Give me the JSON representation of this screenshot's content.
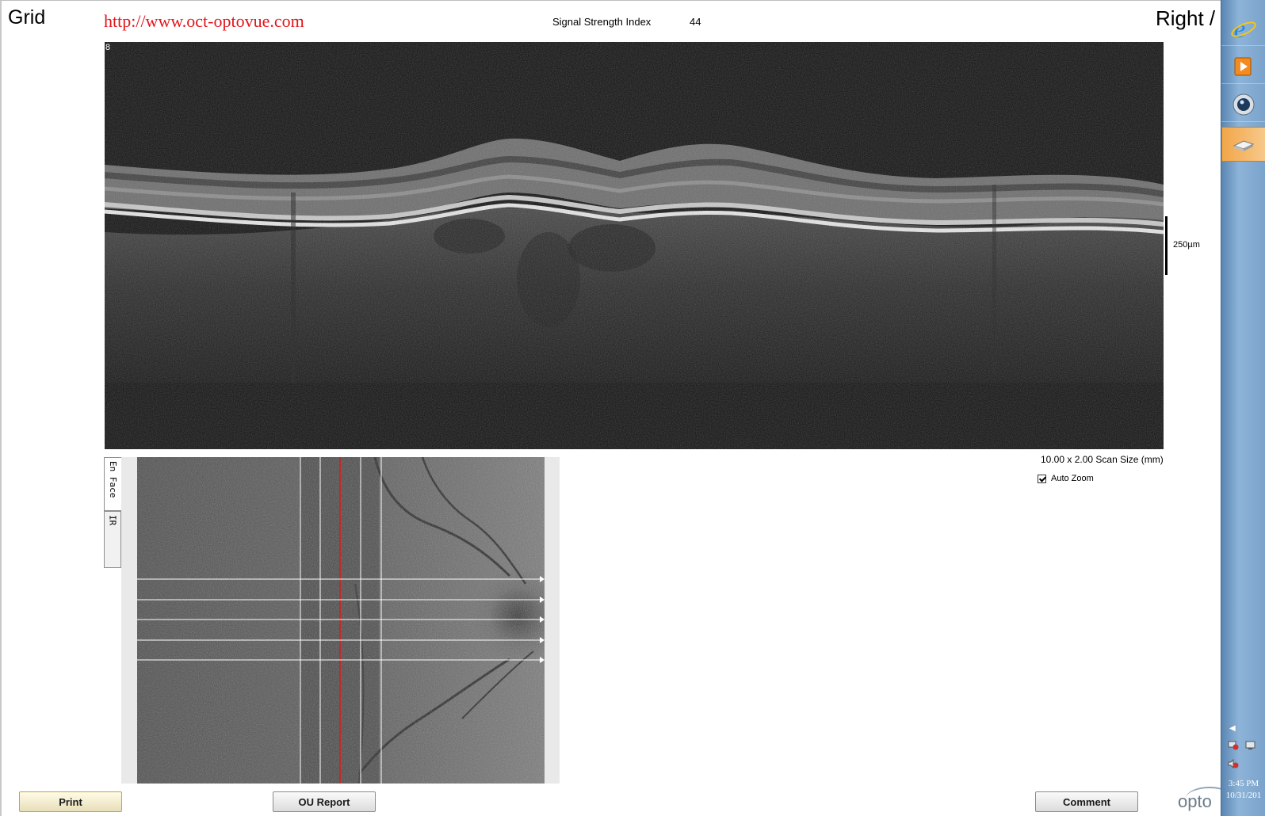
{
  "header": {
    "title": "Grid",
    "url": "http://www.oct-optovue.com",
    "signal_strength_label": "Signal Strength Index",
    "signal_strength_value": "44",
    "eye": "Right /"
  },
  "bscan": {
    "frame_number": "8",
    "scale_label": "250µm"
  },
  "scan_info": {
    "scan_size": "10.00 x 2.00 Scan Size (mm)",
    "auto_zoom_label": "Auto Zoom",
    "auto_zoom_checked": true
  },
  "tabs": [
    {
      "label": "En Face",
      "active": true
    },
    {
      "label": "IR",
      "active": false
    }
  ],
  "buttons": {
    "print": "Print",
    "ou_report": "OU Report",
    "comment": "Comment"
  },
  "logo": {
    "text": "opto"
  },
  "taskbar": {
    "apps": [
      "internet-explorer-icon",
      "media-player-icon",
      "webcam-icon",
      "scanner-icon"
    ],
    "clock_time": "3:45 PM",
    "clock_date": "10/31/201"
  }
}
